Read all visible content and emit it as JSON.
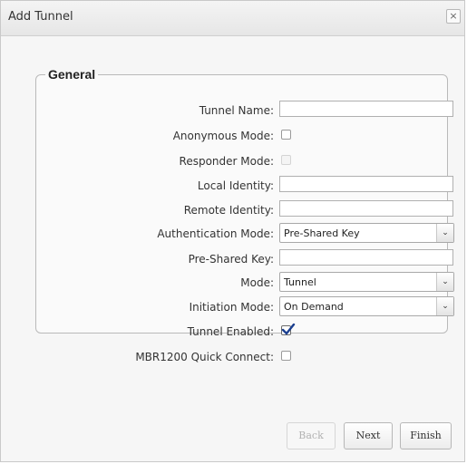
{
  "dialog": {
    "title": "Add Tunnel",
    "close_glyph": "×"
  },
  "group": {
    "legend": "General"
  },
  "fields": {
    "tunnel_name": {
      "label": "Tunnel Name:",
      "value": ""
    },
    "anonymous_mode": {
      "label": "Anonymous Mode:",
      "checked": false
    },
    "responder_mode": {
      "label": "Responder Mode:",
      "checked": false,
      "disabled": true
    },
    "local_identity": {
      "label": "Local Identity:",
      "value": ""
    },
    "remote_identity": {
      "label": "Remote Identity:",
      "value": ""
    },
    "authentication_mode": {
      "label": "Authentication Mode:",
      "value": "Pre-Shared Key"
    },
    "pre_shared_key": {
      "label": "Pre-Shared Key:",
      "value": ""
    },
    "mode": {
      "label": "Mode:",
      "value": "Tunnel"
    },
    "initiation_mode": {
      "label": "Initiation Mode:",
      "value": "On Demand"
    },
    "tunnel_enabled": {
      "label": "Tunnel Enabled:",
      "checked": true
    },
    "quick_connect": {
      "label": "MBR1200 Quick Connect:",
      "checked": false
    }
  },
  "buttons": {
    "back": "Back",
    "next": "Next",
    "finish": "Finish"
  },
  "icons": {
    "select_arrow": "chevron-down-icon",
    "check": "checkmark-icon"
  }
}
